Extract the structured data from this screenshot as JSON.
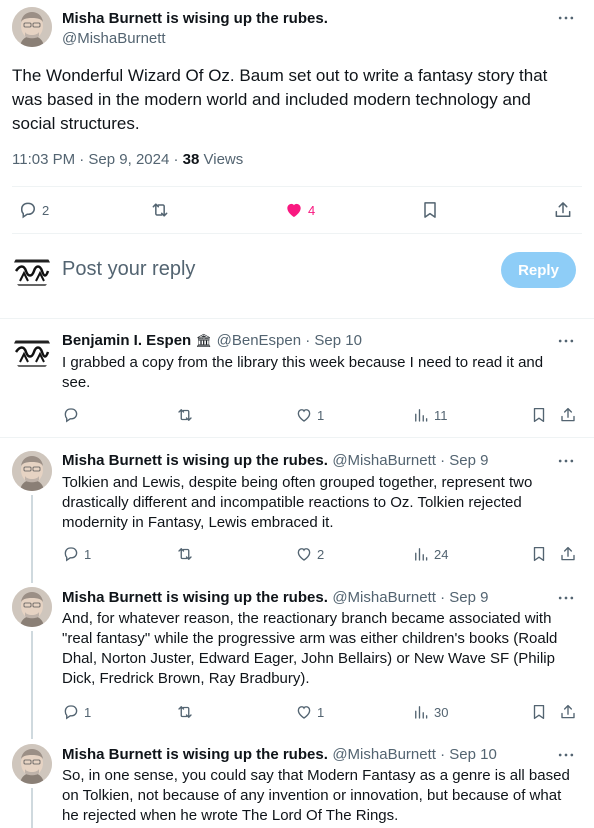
{
  "main_post": {
    "author_name": "Misha Burnett is wising up the rubes.",
    "author_handle": "@MishaBurnett",
    "text": "The Wonderful Wizard Of Oz. Baum set out to write a fantasy story that was based in the modern world and included modern technology and social structures.",
    "time": "11:03 PM · Sep 9, 2024 · ",
    "views_count": "38",
    "views_label": " Views",
    "replies": "2",
    "likes": "4",
    "like_color": "#f91880"
  },
  "composer": {
    "placeholder": "Post your reply",
    "reply_button": "Reply",
    "reply_button_color": "#8ecdf7"
  },
  "replies": [
    {
      "author_name": "Benjamin I. Espen",
      "badge": "🏛",
      "author_handle": "@BenEspen · Sep 10",
      "text": "I grabbed a copy from the library this week because I need to read it and see.",
      "replies": "",
      "reposts": "",
      "likes": "1",
      "views": "11"
    },
    {
      "author_name": "Misha Burnett is wising up the rubes.",
      "author_handle": "@MishaBurnett · Sep 9",
      "text": "Tolkien and Lewis, despite being often grouped together, represent two drastically different and incompatible reactions to Oz. Tolkien rejected modernity in Fantasy, Lewis embraced it.",
      "replies": "1",
      "reposts": "",
      "likes": "2",
      "views": "24"
    },
    {
      "author_name": "Misha Burnett is wising up the rubes.",
      "author_handle": "@MishaBurnett · Sep 9",
      "text": "And, for whatever reason, the reactionary branch became associated with \"real fantasy\" while the progressive arm was either children's books (Roald Dhal, Norton Juster, Edward Eager, John Bellairs) or New Wave SF (Philip Dick, Fredrick Brown, Ray Bradbury).",
      "replies": "1",
      "reposts": "",
      "likes": "1",
      "views": "30"
    },
    {
      "author_name": "Misha Burnett is wising up the rubes.",
      "author_handle": "@MishaBurnett · Sep 10",
      "text": "So, in one sense, you could say that Modern Fantasy as a genre is all based on Tolkien, not because of any invention or innovation, but because of what he rejected when he wrote The Lord Of The Rings."
    }
  ]
}
